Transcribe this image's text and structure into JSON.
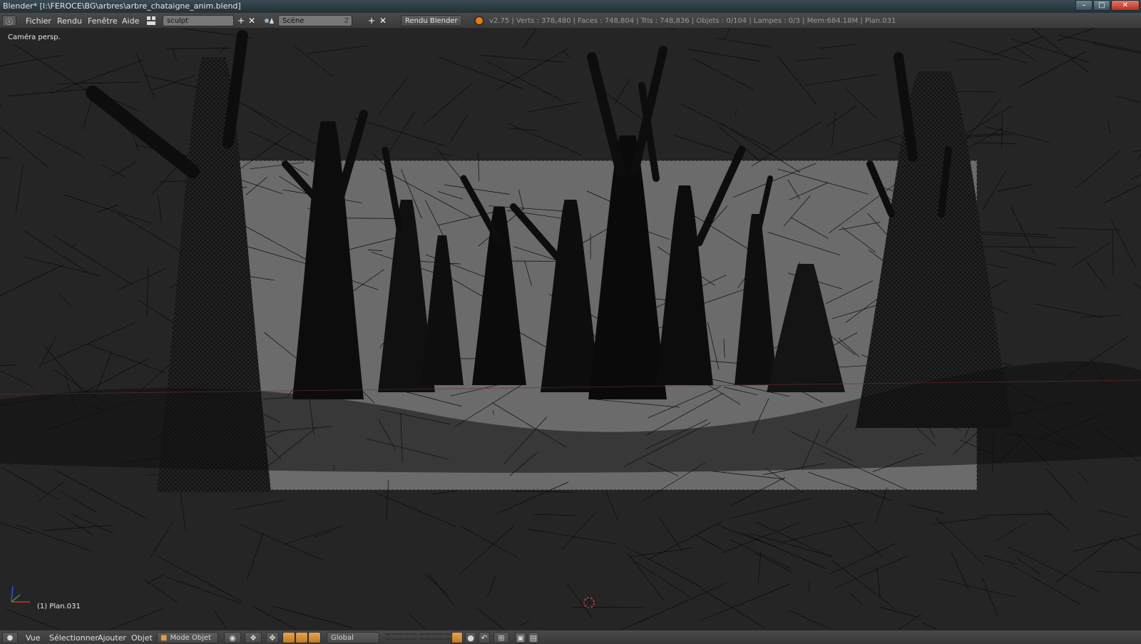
{
  "window": {
    "title": "Blender* [I:\\FEROCE\\BG\\arbres\\arbre_chataigne_anim.blend]",
    "controls": [
      "minimize",
      "maximize",
      "close"
    ]
  },
  "info_header": {
    "menus": [
      "Fichier",
      "Rendu",
      "Fenêtre",
      "Aide"
    ],
    "screen_layout": "sculpt",
    "scene_name": "Scène",
    "scene_users": "2",
    "render_engine": "Rendu Blender",
    "stats": "v2.75 | Verts : 378,480 | Faces : 748,804 | Tris : 748,836 | Objets : 0/104 | Lampes : 0/3 | Mem:684.18M | Plan.031"
  },
  "viewport": {
    "view_label": "Caméra persp.",
    "object_label": "(1) Plan.031"
  },
  "view3d_header": {
    "menus": [
      "Vue",
      "Sélectionner",
      "Ajouter",
      "Objet"
    ],
    "mode": "Mode Objet",
    "orientation": "Global"
  },
  "colors": {
    "viewport_bg": "#393939",
    "wire": "#000000",
    "accent_orange": "#e87d0d",
    "header_bg": "#424242"
  },
  "icons": [
    "info-icon",
    "blender-logo-icon",
    "view3d-icon",
    "cursor-3d-icon",
    "axis-gizmo-icon",
    "close-icon",
    "plus-icon"
  ]
}
